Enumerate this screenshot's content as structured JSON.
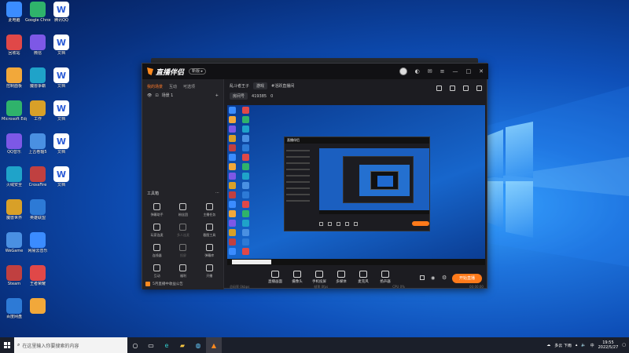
{
  "desktop": {
    "icons_col1": [
      "此电脑",
      "回收站",
      "控制面板",
      "Microsoft Edge",
      "QQ音乐",
      "火绒安全",
      "魔兽世界",
      "WeGame",
      "Steam",
      "百度网盘"
    ],
    "icons_col2": [
      "Google Chrome",
      "微信",
      "魔兽争霸",
      "工作",
      "上古卷轴5",
      "CrossFire",
      "英雄联盟",
      "网易云音乐",
      "王者荣耀",
      ""
    ],
    "icons_col3": [
      "腾讯QQ",
      "文档",
      "文档",
      "文档",
      "文档",
      "文档",
      "",
      "",
      "",
      ""
    ]
  },
  "app": {
    "name": "直播伴侣",
    "version": "新版 ▸",
    "tabs": [
      "我的场景",
      "互动",
      "可选项"
    ],
    "scene": "场景 1",
    "streamer": "乱斗者王子",
    "tag": "游戏",
    "hot": "#活跃直播间",
    "room_id": "419385",
    "fans": "0",
    "tools_header": "工具箱",
    "tools": [
      "弹幕助手",
      "粉丝团",
      "主播任务",
      "玩家连麦",
      "多人连麦",
      "截图工具",
      "连线器",
      "投屏",
      "弹幕库",
      "互动",
      "福利",
      "开播"
    ],
    "notice": "5月直播中收益公告",
    "live_button": "开始直播",
    "bottom_tools": [
      "直播画面",
      "摄像头",
      "手机投屏",
      "多媒体",
      "麦克风",
      "扬声器"
    ],
    "status": [
      "总码率 0kbps",
      "帧率 0fps",
      "CPU 0%",
      "00:00:00"
    ]
  },
  "taskbar": {
    "search_placeholder": "在这里输入你要搜索的内容",
    "weather": "多云 下雨",
    "time": "19:55",
    "date": "2022/5/27",
    "lang": "中"
  }
}
